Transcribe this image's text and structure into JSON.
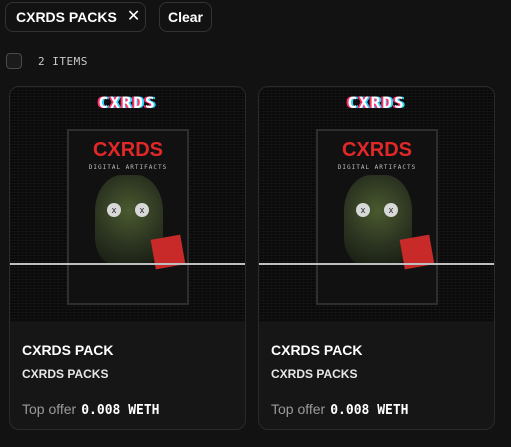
{
  "filters": {
    "chip_label": "CXRDS PACKS",
    "chip_close_icon": "close-icon",
    "clear_label": "Clear"
  },
  "results": {
    "count_label": "2 ITEMS"
  },
  "cards": [
    {
      "art_logo": "CXRDS",
      "art_pack_title": "CXRDS",
      "art_pack_subtitle": "DIGITAL ARTIFACTS",
      "name": "CXRDS PACK",
      "collection": "CXRDS PACKS",
      "offer_label": "Top offer",
      "offer_value": "0.008 WETH"
    },
    {
      "art_logo": "CXRDS",
      "art_pack_title": "CXRDS",
      "art_pack_subtitle": "DIGITAL ARTIFACTS",
      "name": "CXRDS PACK",
      "collection": "CXRDS PACKS",
      "offer_label": "Top offer",
      "offer_value": "0.008 WETH"
    }
  ],
  "colors": {
    "background": "#121212",
    "card_background": "#161616",
    "border": "#333333",
    "accent_red": "#e02828"
  }
}
